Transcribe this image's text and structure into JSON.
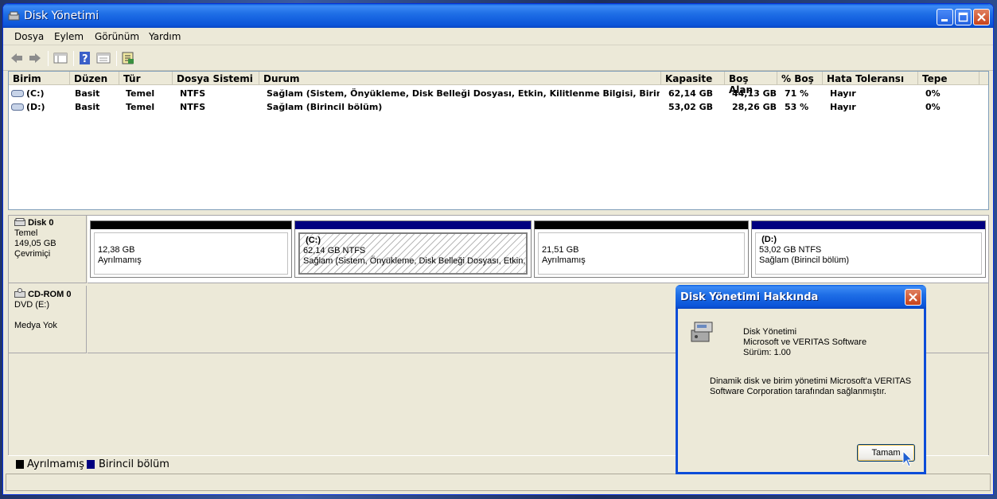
{
  "window": {
    "title": "Disk Yönetimi"
  },
  "menu": [
    "Dosya",
    "Eylem",
    "Görünüm",
    "Yardım"
  ],
  "toolbar": [
    "back-arrow-icon",
    "forward-arrow-icon",
    "show-hide-console-tree-icon",
    "help-icon",
    "properties-icon",
    "export-icon"
  ],
  "volume_list": {
    "columns": [
      "Birim",
      "Düzen",
      "Tür",
      "Dosya Sistemi",
      "Durum",
      "Kapasite",
      "Boş Alan",
      "% Boş",
      "Hata Toleransı",
      "Tepe"
    ],
    "rows": [
      [
        "(C:)",
        "Basit",
        "Temel",
        "NTFS",
        "Sağlam (Sistem, Önyükleme, Disk Belleği Dosyası, Etkin, Kilitlenme Bilgisi, Birincil bölüm)",
        "62,14 GB",
        "44,13 GB",
        "71 %",
        "Hayır",
        "0%"
      ],
      [
        "(D:)",
        "Basit",
        "Temel",
        "NTFS",
        "Sağlam (Birincil bölüm)",
        "53,02 GB",
        "28,26 GB",
        "53 %",
        "Hayır",
        "0%"
      ]
    ]
  },
  "disk0": {
    "name": "Disk 0",
    "type": "Temel",
    "size": "149,05 GB",
    "status": "Çevrimiçi",
    "partitions": [
      {
        "title": "",
        "size": "12,38 GB",
        "status": "Ayrılmamış",
        "color": "#000000"
      },
      {
        "title": "(C:)",
        "size": "62,14 GB NTFS",
        "status": "Sağlam (Sistem, Önyükleme, Disk Belleği Dosyası, Etkin, Kilitl",
        "color": "#000080"
      },
      {
        "title": "",
        "size": "21,51 GB",
        "status": "Ayrılmamış",
        "color": "#000000"
      },
      {
        "title": "(D:)",
        "size": "53,02 GB NTFS",
        "status": "Sağlam (Birincil bölüm)",
        "color": "#000080"
      }
    ]
  },
  "cdrom0": {
    "name": "CD-ROM 0",
    "drive": "DVD (E:)",
    "status": "Medya Yok"
  },
  "legend": [
    {
      "label": "Ayrılmamış",
      "color": "#000000"
    },
    {
      "label": "Birincil bölüm",
      "color": "#000080"
    }
  ],
  "about_dialog": {
    "title": "Disk Yönetimi Hakkında",
    "app_name": "Disk Yönetimi",
    "vendor": "Microsoft ve VERITAS Software",
    "version": "Sürüm: 1.00",
    "description_line1": "Dinamik disk ve birim yönetimi Microsoft'a VERITAS",
    "description_line2": "Software Corporation tarafından sağlanmıştır.",
    "ok_label": "Tamam"
  }
}
